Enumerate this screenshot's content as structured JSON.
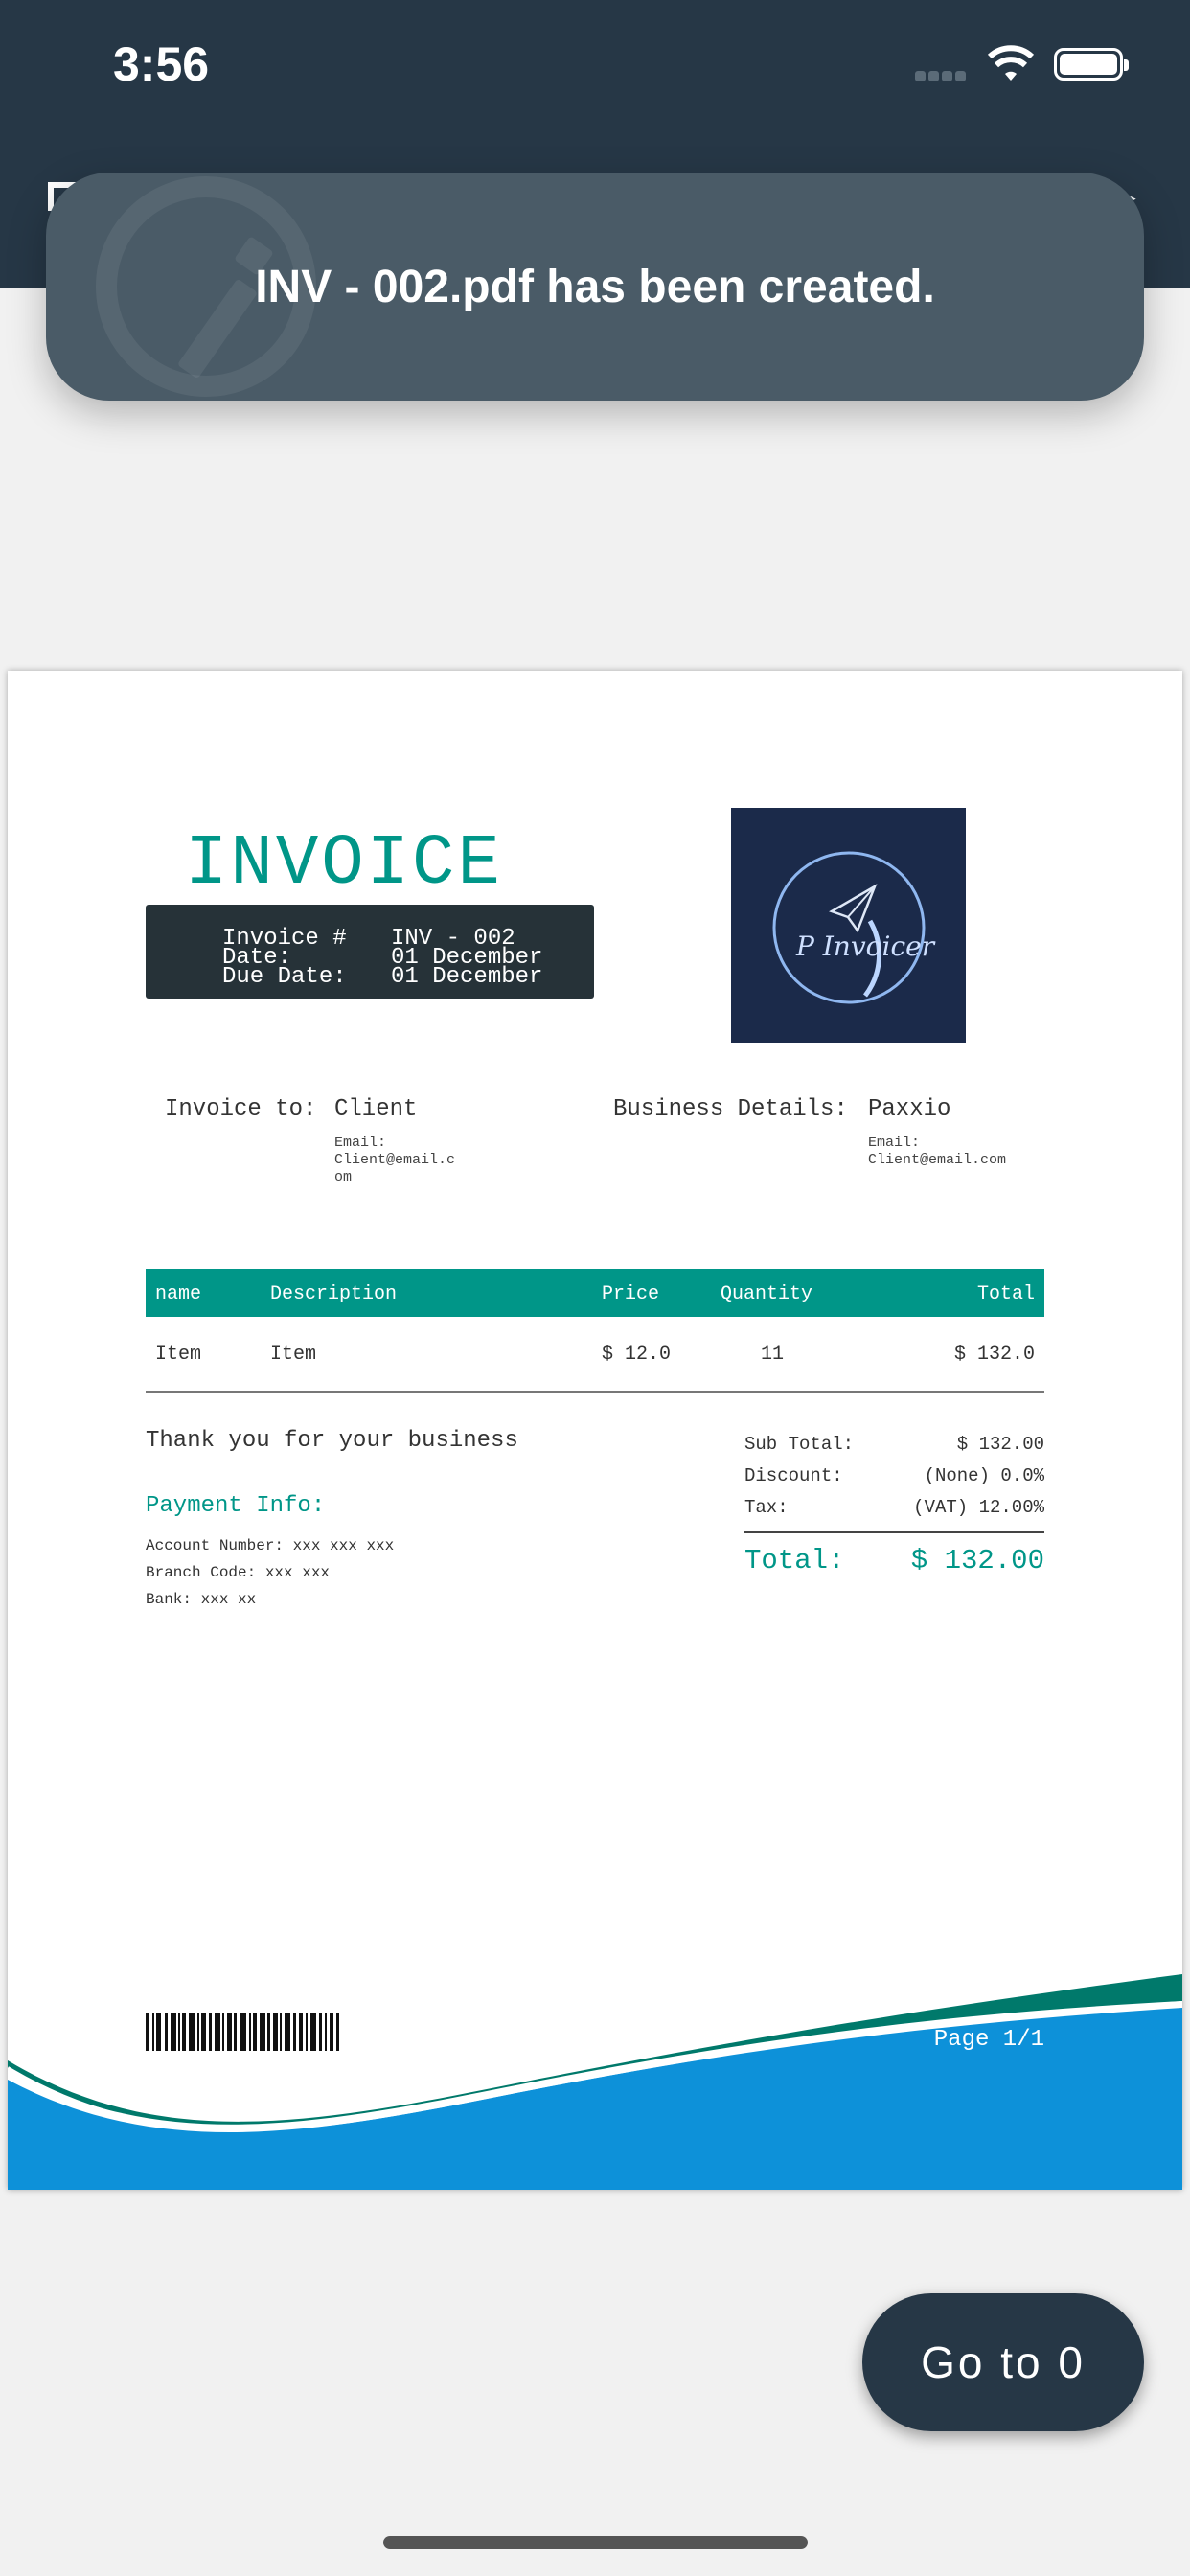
{
  "status": {
    "time": "3:56"
  },
  "toast": {
    "message": "INV - 002.pdf has been created."
  },
  "invoice": {
    "title": "INVOICE",
    "meta": [
      {
        "label": "Invoice #",
        "value": "INV - 002"
      },
      {
        "label": "Date:",
        "value": "01 December"
      },
      {
        "label": "Due Date:",
        "value": "01 December"
      }
    ],
    "logo_text": "P Invoicer",
    "invoice_to": {
      "label": "Invoice to:",
      "name": "Client",
      "email_label": "Email:",
      "email_lines": [
        "Client@email.c",
        "om"
      ]
    },
    "business": {
      "label": "Business Details:",
      "name": "Paxxio",
      "email_label": "Email:",
      "email": "Client@email.com"
    },
    "table": {
      "headers": [
        "name",
        "Description",
        "Price",
        "Quantity",
        "Total"
      ],
      "rows": [
        {
          "name": "Item",
          "description": "Item",
          "price": "$ 12.0",
          "quantity": "11",
          "total": "$ 132.0"
        }
      ]
    },
    "thanks": "Thank you for your business",
    "payment": {
      "title": "Payment Info:",
      "lines": [
        "Account Number: xxx xxx xxx",
        "Branch Code: xxx xxx",
        "Bank: xxx xx"
      ]
    },
    "summary": [
      {
        "label": "Sub Total:",
        "value": "$ 132.00"
      },
      {
        "label": "Discount:",
        "value": "(None) 0.0%"
      },
      {
        "label": "Tax:",
        "value": "(VAT) 12.00%"
      }
    ],
    "total": {
      "label": "Total:",
      "value": "$ 132.00"
    },
    "page": "Page 1/1"
  },
  "fab": {
    "label": "Go to 0"
  },
  "colors": {
    "accent": "#009688",
    "header": "#263746",
    "toast": "#4a5b67",
    "wave_blue": "#0d91d9"
  }
}
